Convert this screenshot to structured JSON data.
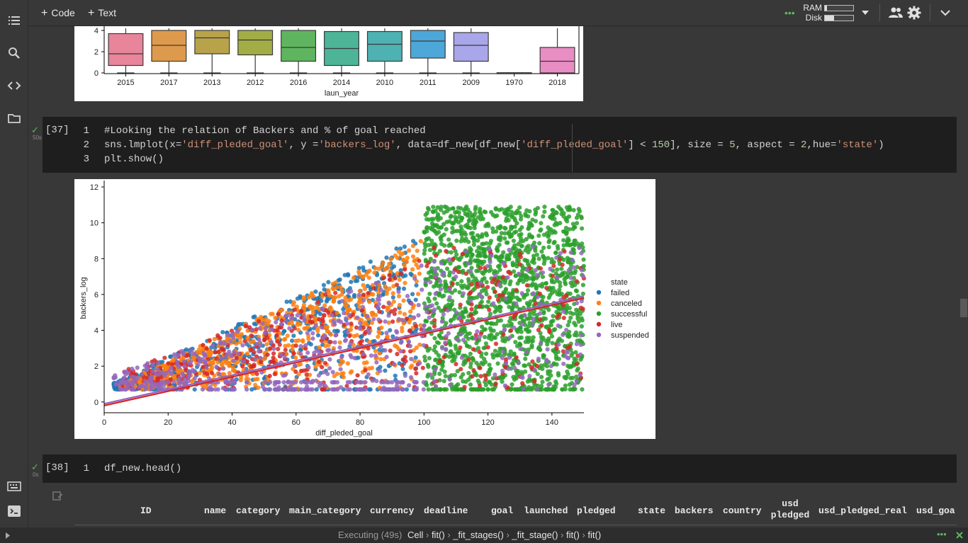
{
  "toolbar": {
    "code_label": "Code",
    "text_label": "Text",
    "ram_label": "RAM",
    "disk_label": "Disk",
    "ram_fill": 0.08,
    "disk_fill": 0.33
  },
  "sidebar": {
    "icons": [
      "toc-icon",
      "search-icon",
      "code-snippets-icon",
      "files-icon",
      "command-palette-icon",
      "terminal-icon"
    ]
  },
  "boxplot": {
    "categories": [
      "2015",
      "2017",
      "2013",
      "2012",
      "2016",
      "2014",
      "2010",
      "2011",
      "2009",
      "1970",
      "2018"
    ],
    "ylabel_ticks": [
      "4",
      "2",
      "0"
    ],
    "xlabel": "laun_year",
    "colors": [
      "#e8859b",
      "#de9a4c",
      "#b8a34b",
      "#a3ad45",
      "#5fb55f",
      "#4db498",
      "#4eb2b3",
      "#4da7d8",
      "#aaa6ea",
      "#cc88e0",
      "#e88ec4"
    ],
    "boxes": [
      {
        "q1": 0.7,
        "med": 1.8,
        "q3": 3.7,
        "wlo": 0,
        "whi": 4.2
      },
      {
        "q1": 1.1,
        "med": 2.6,
        "q3": 4.0,
        "wlo": 0,
        "whi": 4.2
      },
      {
        "q1": 1.8,
        "med": 3.3,
        "q3": 4.0,
        "wlo": 0,
        "whi": 4.2
      },
      {
        "q1": 1.7,
        "med": 3.1,
        "q3": 4.0,
        "wlo": 0,
        "whi": 4.2
      },
      {
        "q1": 1.1,
        "med": 2.4,
        "q3": 4.0,
        "wlo": 0,
        "whi": 4.2
      },
      {
        "q1": 0.7,
        "med": 2.3,
        "q3": 3.9,
        "wlo": 0,
        "whi": 4.2
      },
      {
        "q1": 1.1,
        "med": 2.7,
        "q3": 3.9,
        "wlo": 0,
        "whi": 4.2
      },
      {
        "q1": 1.4,
        "med": 3.0,
        "q3": 4.0,
        "wlo": 0,
        "whi": 4.2
      },
      {
        "q1": 1.1,
        "med": 2.6,
        "q3": 3.8,
        "wlo": 0,
        "whi": 4.2
      },
      {
        "q1": 0,
        "med": 0,
        "q3": 0.02,
        "wlo": 0,
        "whi": 0.02
      },
      {
        "q1": 0,
        "med": 1.1,
        "q3": 2.4,
        "wlo": 0,
        "whi": 4.2
      }
    ]
  },
  "cell37": {
    "number": "[37]",
    "time": "50s",
    "lines": [
      "1",
      "2",
      "3"
    ],
    "line1_comment": "#Looking the relation of Backers and % of goal reached",
    "line2_a": "sns.lmplot(x=",
    "line2_s1": "'diff_pleded_goal'",
    "line2_b": ", y =",
    "line2_s2": "'backers_log'",
    "line2_c": ", data=df_new[df_new[",
    "line2_s3": "'diff_pleded_goal'",
    "line2_d": "] < ",
    "line2_n1": "150",
    "line2_e": "], size = ",
    "line2_n2": "5",
    "line2_f": ", aspect = ",
    "line2_n3": "2",
    "line2_g": ",hue=",
    "line2_s4": "'state'",
    "line2_h": ")",
    "line3": "plt.show()"
  },
  "chart_data": {
    "type": "scatter",
    "xlabel": "diff_pleded_goal",
    "ylabel": "backers_log",
    "xlim": [
      0,
      150
    ],
    "ylim": [
      -0.6,
      12.2
    ],
    "xticks": [
      "0",
      "20",
      "40",
      "60",
      "80",
      "100",
      "120",
      "140"
    ],
    "yticks": [
      "0",
      "2",
      "4",
      "6",
      "8",
      "10",
      "12"
    ],
    "legend_title": "state",
    "legend_position": "right",
    "series": [
      {
        "name": "failed",
        "color": "#1f77b4",
        "x_range": [
          0,
          100
        ],
        "y_mode": "failed"
      },
      {
        "name": "canceled",
        "color": "#ff7f0e",
        "x_range": [
          0,
          100
        ],
        "y_mode": "canceled"
      },
      {
        "name": "successful",
        "color": "#2ca02c",
        "x_range": [
          100,
          150
        ],
        "y_mode": "successful"
      },
      {
        "name": "live",
        "color": "#d62728",
        "x_range": [
          0,
          150
        ],
        "y_mode": "live"
      },
      {
        "name": "suspended",
        "color": "#9467bd",
        "x_range": [
          0,
          150
        ],
        "y_mode": "suspended"
      }
    ],
    "regression_lines": [
      {
        "color": "#9467bd",
        "x0": 0,
        "y0": -0.1,
        "x1": 150,
        "y1": 5.9
      },
      {
        "color": "#d62728",
        "x0": 0,
        "y0": -0.2,
        "x1": 150,
        "y1": 5.8
      }
    ]
  },
  "cell38": {
    "number": "[38]",
    "time": "0s",
    "line": "1",
    "code": "df_new.head()"
  },
  "table_header": {
    "columns": [
      "ID",
      "name",
      "category",
      "main_category",
      "currency",
      "deadline",
      "goal",
      "launched",
      "pledged",
      "state",
      "backers",
      "country",
      "usd pledged",
      "usd_pledged_real",
      "usd_goa"
    ]
  },
  "statusbar": {
    "executing": "Executing (49s)",
    "cell": "Cell",
    "crumbs": [
      "fit()",
      "_fit_stages()",
      "_fit_stage()",
      "fit()",
      "fit()"
    ]
  }
}
